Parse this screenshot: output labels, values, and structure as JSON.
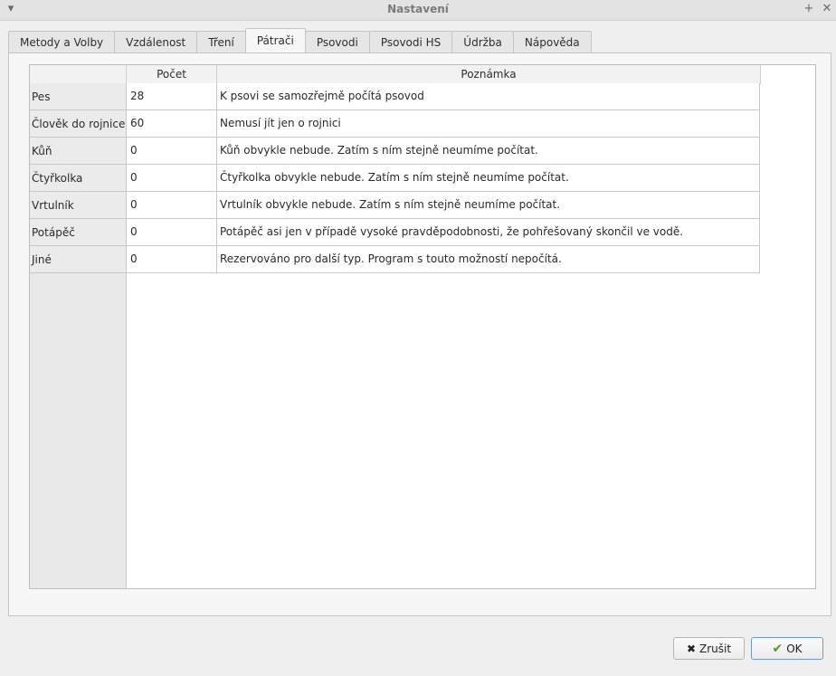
{
  "window": {
    "title": "Nastavení",
    "menu_icon": "chevron-down-icon",
    "pin_icon": "plus-icon",
    "close_icon": "close-icon"
  },
  "tabs": [
    {
      "label": "Metody a Volby"
    },
    {
      "label": "Vzdálenost"
    },
    {
      "label": "Tření"
    },
    {
      "label": "Pátrači",
      "active": true
    },
    {
      "label": "Psovodi"
    },
    {
      "label": "Psovodi HS"
    },
    {
      "label": "Údržba"
    },
    {
      "label": "Nápověda"
    }
  ],
  "table": {
    "headers": [
      "Počet",
      "Poznámka"
    ],
    "rows": [
      {
        "name": "Pes",
        "count": "28",
        "note": "K psovi se samozřejmě počítá psovod"
      },
      {
        "name": "Člověk do rojnice",
        "count": "60",
        "note": "Nemusí jít jen o rojnici"
      },
      {
        "name": "Kůň",
        "count": "0",
        "note": "Kůň obvykle nebude. Zatím s ním stejně neumíme počítat."
      },
      {
        "name": "Čtyřkolka",
        "count": "0",
        "note": "Čtyřkolka obvykle nebude. Zatím s ním stejně neumíme počítat."
      },
      {
        "name": "Vrtulník",
        "count": "0",
        "note": "Vrtulník obvykle nebude. Zatím s ním stejně neumíme počítat."
      },
      {
        "name": "Potápěč",
        "count": "0",
        "note": "Potápěč asi jen v případě vysoké pravděpodobnosti, že pohřešovaný skončil ve vodě."
      },
      {
        "name": "Jiné",
        "count": "0",
        "note": "Rezervováno pro další typ. Program s touto možností nepočítá."
      }
    ]
  },
  "buttons": {
    "cancel": {
      "label": "Zrušit",
      "icon": "cross-icon"
    },
    "ok": {
      "label": "OK",
      "icon": "checkmark-icon",
      "accent": "#6a9ac8"
    }
  }
}
